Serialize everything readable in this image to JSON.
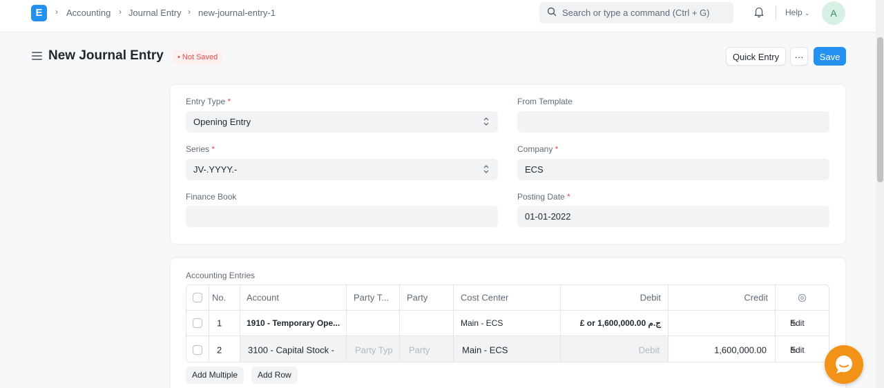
{
  "navbar": {
    "logo_letter": "E",
    "breadcrumbs": [
      "Accounting",
      "Journal Entry",
      "new-journal-entry-1"
    ],
    "search_placeholder": "Search or type a command (Ctrl + G)",
    "help_label": "Help",
    "avatar_initial": "A"
  },
  "page": {
    "title": "New Journal Entry",
    "status_badge": "Not Saved",
    "quick_entry_label": "Quick Entry",
    "more_label": "···",
    "save_label": "Save"
  },
  "form": {
    "entry_type": {
      "label": "Entry Type",
      "value": "Opening Entry"
    },
    "from_template": {
      "label": "From Template",
      "value": ""
    },
    "series": {
      "label": "Series",
      "value": "JV-.YYYY.-"
    },
    "company": {
      "label": "Company",
      "value": "ECS"
    },
    "finance_book": {
      "label": "Finance Book",
      "value": ""
    },
    "posting_date": {
      "label": "Posting Date",
      "value": "01-01-2022"
    },
    "required_mark": "*"
  },
  "accounts": {
    "section_label": "Accounting Entries",
    "columns": [
      "No.",
      "Account",
      "Party T...",
      "Party",
      "Cost Center",
      "Debit",
      "Credit"
    ],
    "rows": [
      {
        "no": "1",
        "account": "1910 - Temporary Ope...",
        "party_type": "",
        "party": "",
        "cost_center": "Main - ECS",
        "debit": "ج.م 1,600,000.00 or £",
        "credit": "",
        "edit": "Edit"
      },
      {
        "no": "2",
        "account": "3100 - Capital Stock -",
        "party_type": "Party Typ",
        "party": "Party",
        "cost_center": "Main - ECS",
        "debit": "Debit",
        "credit": "1,600,000.00",
        "edit": "Edit"
      }
    ],
    "add_multiple_label": "Add Multiple",
    "add_row_label": "Add Row"
  },
  "colors": {
    "accent": "#2490ef",
    "chat": "#f29318",
    "not_saved": "#e24c4c"
  }
}
